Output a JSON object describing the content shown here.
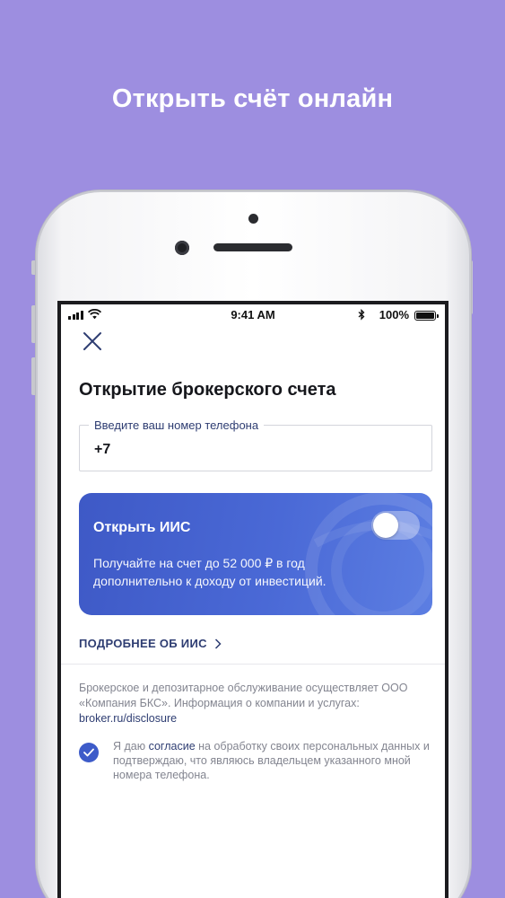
{
  "promo": {
    "headline": "Открыть счёт онлайн"
  },
  "status_bar": {
    "time": "9:41 AM",
    "battery": "100%"
  },
  "form": {
    "title": "Открытие брокерского счета",
    "phone_label": "Введите ваш номер телефона",
    "phone_value": "+7"
  },
  "iis_card": {
    "title": "Открыть ИИС",
    "description": "Получайте на счет до 52 000 ₽ в год дополнительно к доходу от инвестиций.",
    "toggle_on": false
  },
  "more_link": {
    "label": "ПОДРОБНЕЕ ОБ ИИС"
  },
  "disclaimer": {
    "text": "Брокерское и депозитарное обслуживание осуществляет ООО «Компания БКС». Информация о компании и услугах:",
    "link": "broker.ru/disclosure"
  },
  "consent": {
    "prefix": "Я даю ",
    "link": "согласие",
    "suffix": " на обработку своих персональных данных и подтверждаю, что являюсь владельцем указанного мной номера телефона.",
    "checked": true
  },
  "colors": {
    "background": "#9d8ee0",
    "accent_blue": "#3d5bc9",
    "link_navy": "#2e3d72"
  }
}
